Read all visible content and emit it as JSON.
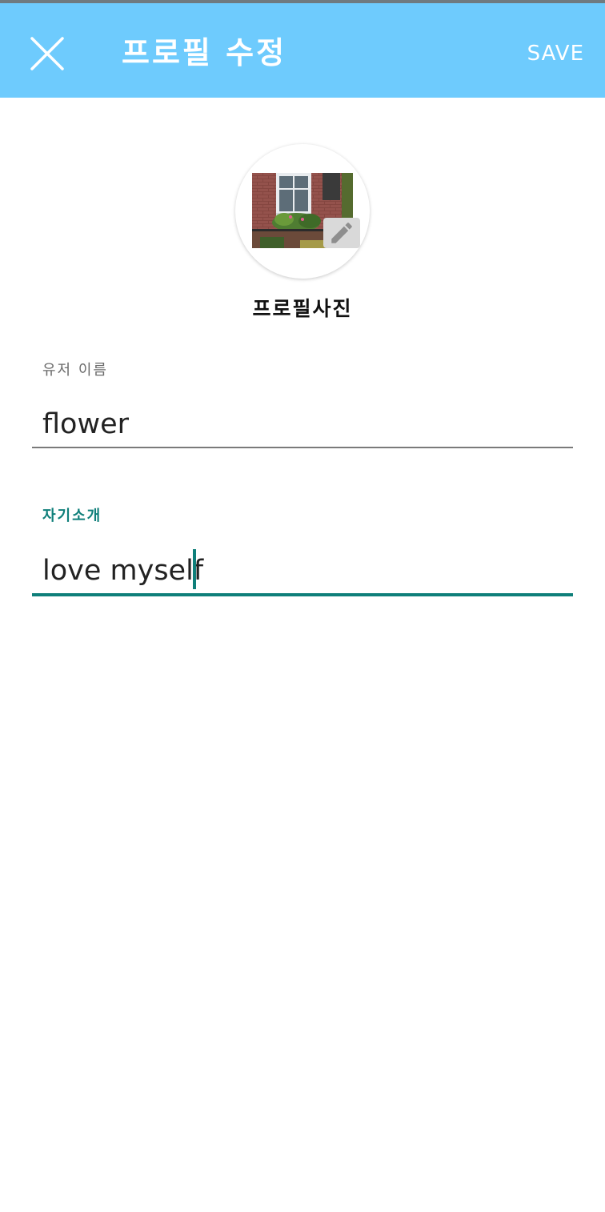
{
  "colors": {
    "app_bar": "#6ecbfd",
    "accent": "#0f7f7a",
    "text_on_bar": "#ffffff"
  },
  "app_bar": {
    "title": "프로필 수정",
    "close_icon": "close-icon",
    "save_label": "SAVE"
  },
  "profile": {
    "photo_label": "프로필사진",
    "edit_icon": "pencil-icon"
  },
  "form": {
    "username": {
      "label": "유저 이름",
      "value": "flower"
    },
    "bio": {
      "label": "자기소개",
      "value": "love myself"
    }
  }
}
